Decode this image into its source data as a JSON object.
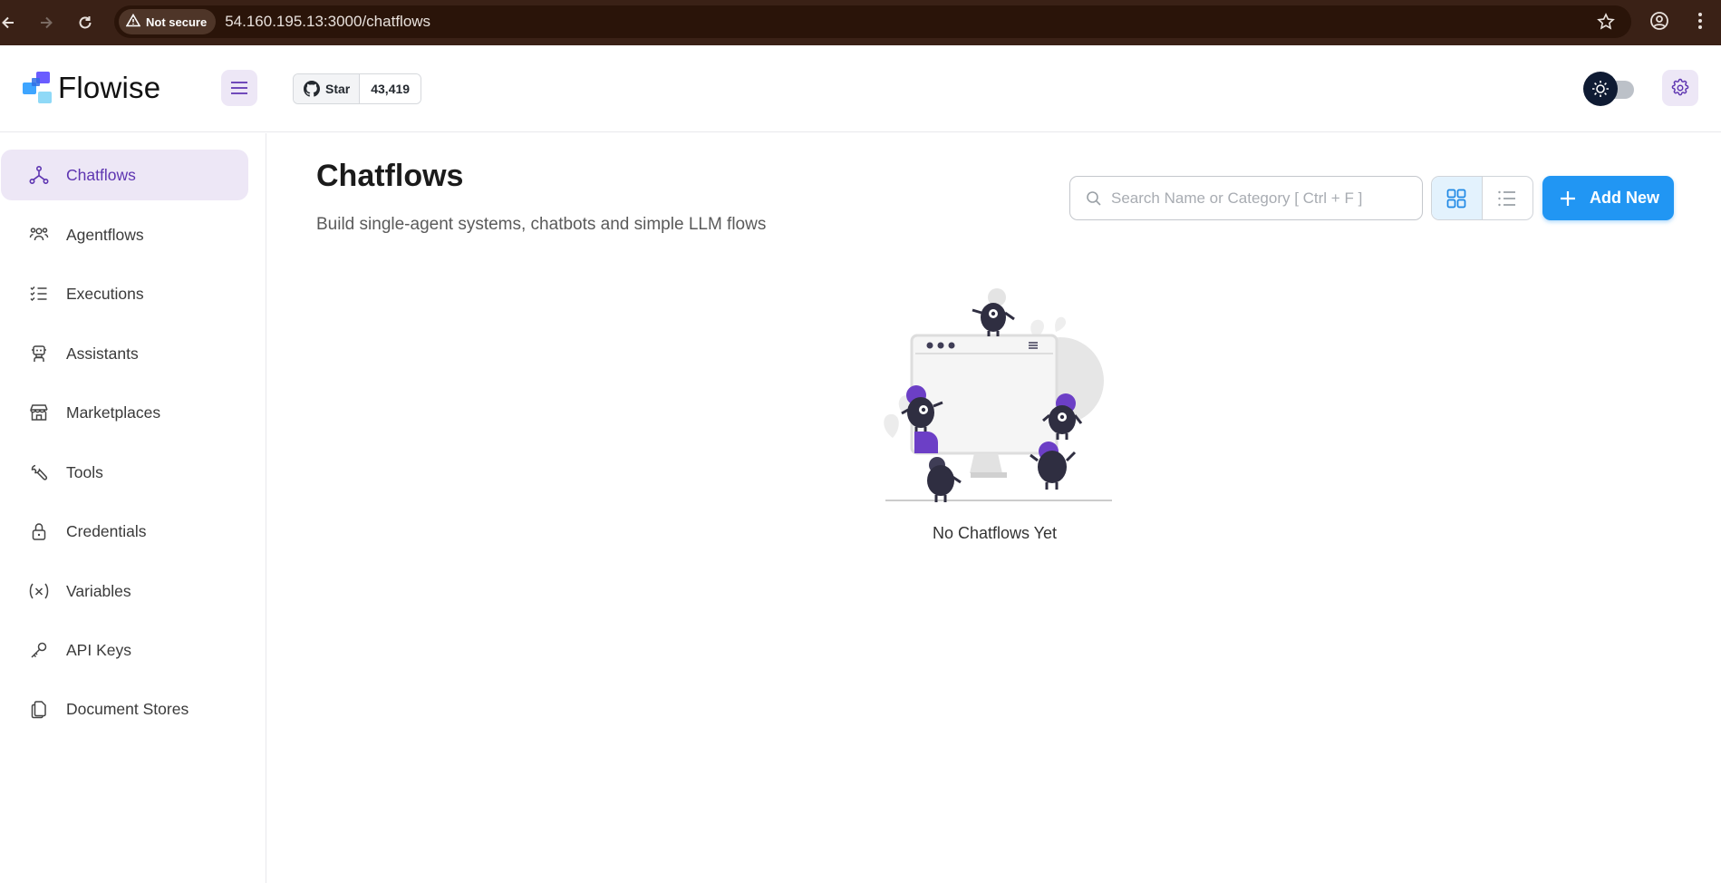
{
  "browser": {
    "security_label": "Not secure",
    "url": "54.160.195.13:3000/chatflows"
  },
  "header": {
    "app_name": "Flowise",
    "github_star_label": "Star",
    "github_star_count": "43,419"
  },
  "sidebar": {
    "items": [
      {
        "label": "Chatflows",
        "icon": "chatflows-icon",
        "active": true
      },
      {
        "label": "Agentflows",
        "icon": "users-icon"
      },
      {
        "label": "Executions",
        "icon": "checklist-icon"
      },
      {
        "label": "Assistants",
        "icon": "robot-icon"
      },
      {
        "label": "Marketplaces",
        "icon": "store-icon"
      },
      {
        "label": "Tools",
        "icon": "wrench-icon"
      },
      {
        "label": "Credentials",
        "icon": "lock-icon"
      },
      {
        "label": "Variables",
        "icon": "variable-icon"
      },
      {
        "label": "API Keys",
        "icon": "key-icon"
      },
      {
        "label": "Document Stores",
        "icon": "files-icon"
      }
    ]
  },
  "main": {
    "title": "Chatflows",
    "subtitle": "Build single-agent systems, chatbots and simple LLM flows",
    "search_placeholder": "Search Name or Category [ Ctrl + F ]",
    "add_button_label": "Add New",
    "empty_state_text": "No Chatflows Yet"
  },
  "colors": {
    "accent_purple": "#5e35b1",
    "accent_blue": "#2196f3",
    "active_bg": "#ede7f6"
  }
}
